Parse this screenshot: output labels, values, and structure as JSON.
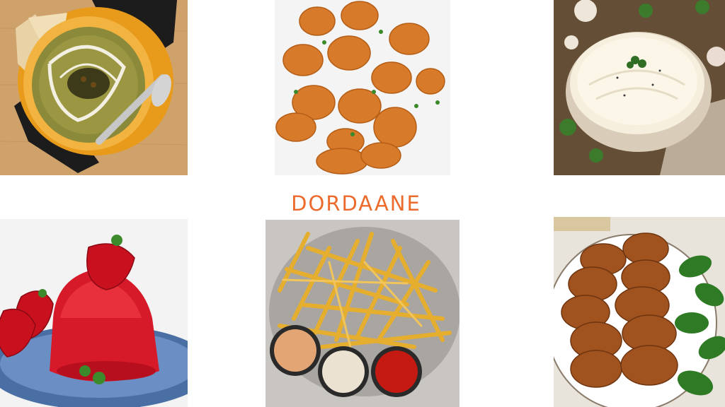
{
  "brand": {
    "name": "DORDAANE",
    "color": "#ec6a2c"
  },
  "gallery": [
    {
      "id": "soup",
      "icon": "herb-soup-bowl-photo"
    },
    {
      "id": "nuggets",
      "icon": "fried-chicken-nuggets-photo"
    },
    {
      "id": "mayo",
      "icon": "mayonnaise-bowl-photo"
    },
    {
      "id": "jelly",
      "icon": "red-jelly-with-strawberries-photo"
    },
    {
      "id": "fries",
      "icon": "french-fries-with-sauces-photo"
    },
    {
      "id": "cutlets",
      "icon": "potato-cutlets-with-basil-photo"
    }
  ]
}
